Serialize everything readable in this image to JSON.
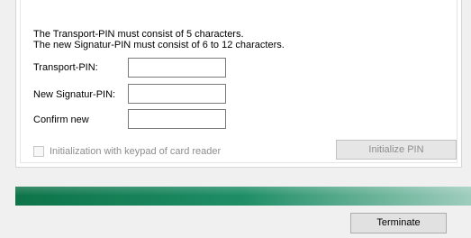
{
  "dialog": {
    "info_line1": "The Transport-PIN must consist of 5 characters.",
    "info_line2": "The new Signatur-PIN must consist of 6 to 12 characters.",
    "fields": [
      {
        "label": "Transport-PIN:",
        "value": ""
      },
      {
        "label": "New Signatur-PIN:",
        "value": ""
      },
      {
        "label": "Confirm new",
        "value": ""
      }
    ],
    "keypad_checkbox_label": "Initialization with keypad of card reader",
    "keypad_checkbox_checked": false,
    "initialize_button": "Initialize PIN"
  },
  "progress": {
    "fraction": 1.0,
    "color_start": "#0e7449",
    "color_end": "#9fcdbd"
  },
  "footer": {
    "terminate_button": "Terminate"
  }
}
